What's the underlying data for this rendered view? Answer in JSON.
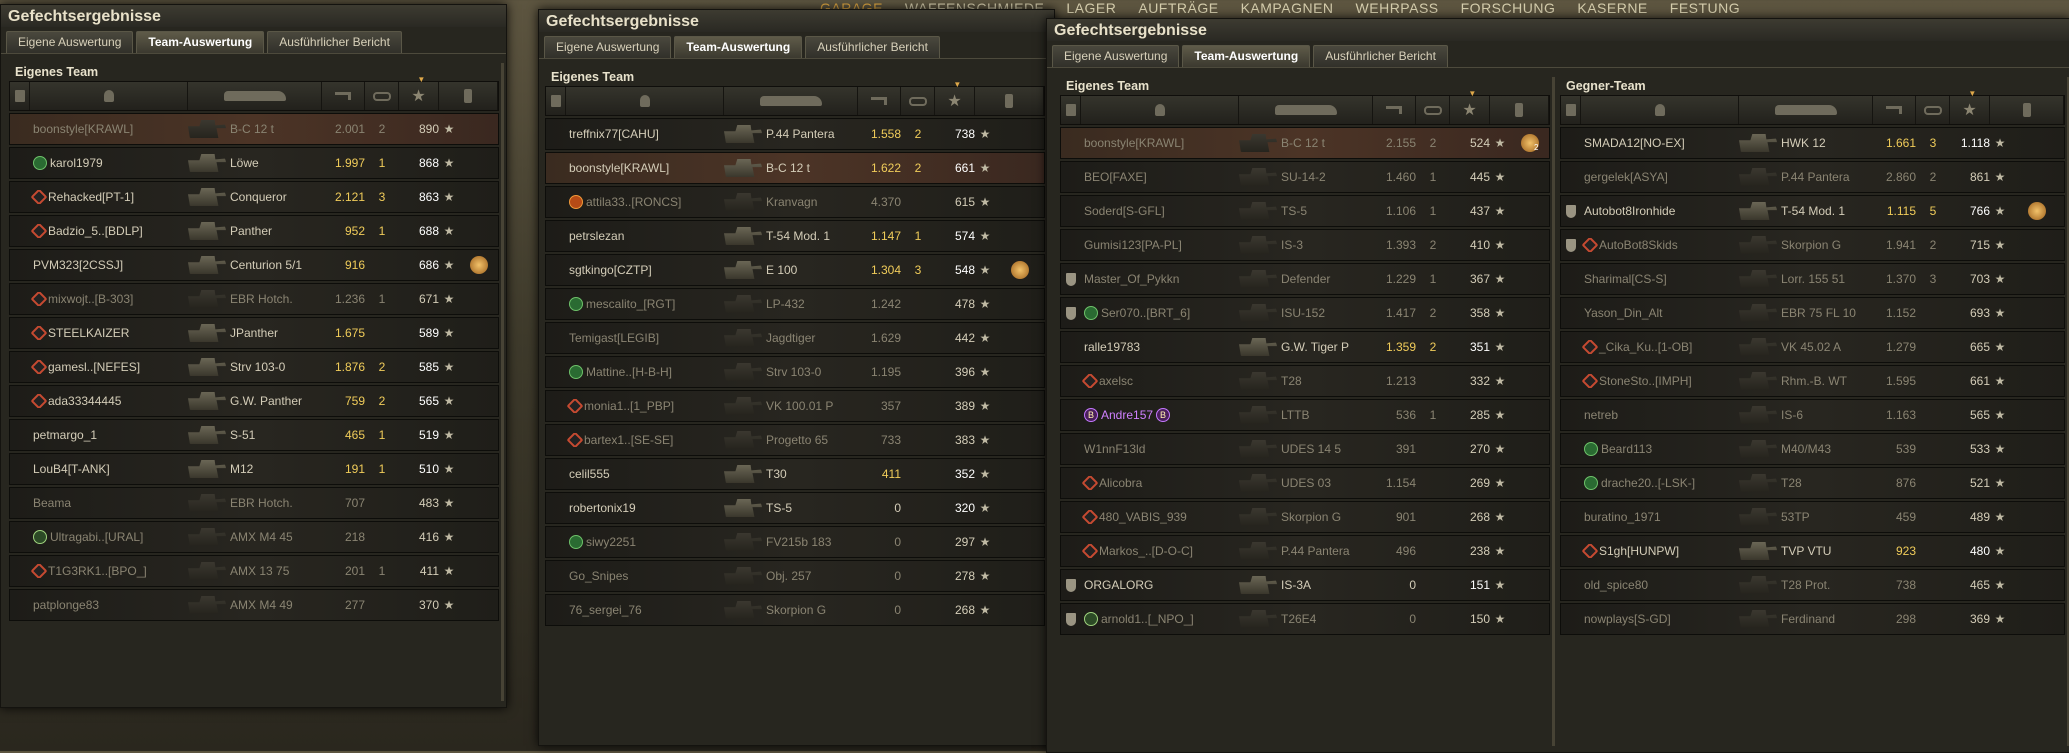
{
  "top_menu": [
    "GARAGE",
    "WAFFENSCHMIEDE",
    "LAGER",
    "AUFTRÄGE",
    "KAMPAGNEN",
    "WEHRPASS",
    "FORSCHUNG",
    "KASERNE",
    "FESTUNG"
  ],
  "windows": [
    {
      "title": "Gefechtsergebnisse",
      "tabs": [
        "Eigene Auswertung",
        "Team-Auswertung",
        "Ausführlicher Bericht"
      ],
      "active_tab": 1,
      "teams": [
        {
          "title": "Eigenes Team",
          "rows": [
            {
              "name": "boonstyle[KRAWL]",
              "tank": "B-C 12 t",
              "dmg": "2.001",
              "frags": "2",
              "xp": "890",
              "self": true,
              "dead": true
            },
            {
              "name": "karol1979",
              "tank": "Löwe",
              "dmg": "1.997",
              "frags": "1",
              "xp": "868",
              "badge": "green"
            },
            {
              "name": "Rehacked[PT-1]",
              "tank": "Conqueror",
              "dmg": "2.121",
              "frags": "3",
              "xp": "863",
              "badge": "rank"
            },
            {
              "name": "Badzio_5..[BDLP]",
              "tank": "Panther",
              "dmg": "952",
              "frags": "1",
              "xp": "688",
              "badge": "rank"
            },
            {
              "name": "PVM323[2CSSJ]",
              "tank": "Centurion 5/1",
              "dmg": "916",
              "frags": "",
              "xp": "686",
              "medal": true
            },
            {
              "name": "mixwojt..[B-303]",
              "tank": "EBR Hotch.",
              "dmg": "1.236",
              "frags": "1",
              "xp": "671",
              "badge": "rank",
              "dead": true
            },
            {
              "name": "STEELKAIZER",
              "tank": "JPanther",
              "dmg": "1.675",
              "frags": "",
              "xp": "589",
              "badge": "rank"
            },
            {
              "name": "gamesl..[NEFES]",
              "tank": "Strv 103-0",
              "dmg": "1.876",
              "frags": "2",
              "xp": "585",
              "badge": "rank"
            },
            {
              "name": "ada33344445",
              "tank": "G.W. Panther",
              "dmg": "759",
              "frags": "2",
              "xp": "565",
              "badge": "rank"
            },
            {
              "name": "petmargo_1",
              "tank": "S-51",
              "dmg": "465",
              "frags": "1",
              "xp": "519"
            },
            {
              "name": "LouB4[T-ANK]",
              "tank": "M12",
              "dmg": "191",
              "frags": "1",
              "xp": "510"
            },
            {
              "name": "Beama",
              "tank": "EBR Hotch.",
              "dmg": "707",
              "frags": "",
              "xp": "483",
              "dead": true
            },
            {
              "name": "Ultragabi..[URAL]",
              "tank": "AMX M4 45",
              "dmg": "218",
              "frags": "",
              "xp": "416",
              "badge": "star",
              "dead": true
            },
            {
              "name": "T1G3RK1..[BPO_]",
              "tank": "AMX 13 75",
              "dmg": "201",
              "frags": "1",
              "xp": "411",
              "badge": "rank",
              "dead": true
            },
            {
              "name": "patplonge83",
              "tank": "AMX M4 49",
              "dmg": "277",
              "frags": "",
              "xp": "370",
              "dead": true
            }
          ]
        }
      ]
    },
    {
      "title": "Gefechtsergebnisse",
      "tabs": [
        "Eigene Auswertung",
        "Team-Auswertung",
        "Ausführlicher Bericht"
      ],
      "active_tab": 1,
      "teams": [
        {
          "title": "Eigenes Team",
          "rows": [
            {
              "name": "treffnix77[CAHU]",
              "tank": "P.44 Pantera",
              "dmg": "1.558",
              "frags": "2",
              "xp": "738"
            },
            {
              "name": "boonstyle[KRAWL]",
              "tank": "B-C 12 t",
              "dmg": "1.622",
              "frags": "2",
              "xp": "661",
              "self": true
            },
            {
              "name": "attila33..[RONCS]",
              "tank": "Kranvagn",
              "dmg": "4.370",
              "frags": "",
              "xp": "615",
              "badge": "orange",
              "dead": true
            },
            {
              "name": "petrslezan",
              "tank": "T-54 Mod. 1",
              "dmg": "1.147",
              "frags": "1",
              "xp": "574"
            },
            {
              "name": "sgtkingo[CZTP]",
              "tank": "E 100",
              "dmg": "1.304",
              "frags": "3",
              "xp": "548",
              "medal": true
            },
            {
              "name": "mescalito_[RGT]",
              "tank": "LP-432",
              "dmg": "1.242",
              "frags": "",
              "xp": "478",
              "badge": "green",
              "dead": true
            },
            {
              "name": "Temigast[LEGIB]",
              "tank": "Jagdtiger",
              "dmg": "1.629",
              "frags": "",
              "xp": "442",
              "dead": true
            },
            {
              "name": "Mattine..[H-B-H]",
              "tank": "Strv 103-0",
              "dmg": "1.195",
              "frags": "",
              "xp": "396",
              "badge": "green",
              "dead": true
            },
            {
              "name": "monia1..[1_PBP]",
              "tank": "VK 100.01 P",
              "dmg": "357",
              "frags": "",
              "xp": "389",
              "badge": "rank",
              "dead": true
            },
            {
              "name": "bartex1..[SE-SE]",
              "tank": "Progetto 65",
              "dmg": "733",
              "frags": "",
              "xp": "383",
              "badge": "rank",
              "dead": true
            },
            {
              "name": "celil555",
              "tank": "T30",
              "dmg": "411",
              "frags": "",
              "xp": "352"
            },
            {
              "name": "robertonix19",
              "tank": "TS-5",
              "dmg": "0",
              "frags": "",
              "xp": "320"
            },
            {
              "name": "siwy2251",
              "tank": "FV215b 183",
              "dmg": "0",
              "frags": "",
              "xp": "297",
              "badge": "green",
              "dead": true
            },
            {
              "name": "Go_Snipes",
              "tank": "Obj. 257",
              "dmg": "0",
              "frags": "",
              "xp": "278",
              "dead": true
            },
            {
              "name": "76_sergei_76",
              "tank": "Skorpion G",
              "dmg": "0",
              "frags": "",
              "xp": "268",
              "dead": true
            }
          ]
        }
      ]
    },
    {
      "title": "Gefechtsergebnisse",
      "tabs": [
        "Eigene Auswertung",
        "Team-Auswertung",
        "Ausführlicher Bericht"
      ],
      "active_tab": 1,
      "teams": [
        {
          "title": "Eigenes Team",
          "rows": [
            {
              "name": "boonstyle[KRAWL]",
              "tank": "B-C 12 t",
              "dmg": "2.155",
              "frags": "2",
              "xp": "524",
              "self": true,
              "dead": true,
              "medal": true,
              "medal_num": "2"
            },
            {
              "name": "BEO[FAXE]",
              "tank": "SU-14-2",
              "dmg": "1.460",
              "frags": "1",
              "xp": "445",
              "dead": true
            },
            {
              "name": "Soderd[S-GFL]",
              "tank": "TS-5",
              "dmg": "1.106",
              "frags": "1",
              "xp": "437",
              "dead": true
            },
            {
              "name": "Gumisi123[PA-PL]",
              "tank": "IS-3",
              "dmg": "1.393",
              "frags": "2",
              "xp": "410",
              "dead": true
            },
            {
              "name": "Master_Of_Pykkn",
              "tank": "Defender",
              "dmg": "1.229",
              "frags": "1",
              "xp": "367",
              "plat": true,
              "dead": true
            },
            {
              "name": "Ser070..[BRT_6]",
              "tank": "ISU-152",
              "dmg": "1.417",
              "frags": "2",
              "xp": "358",
              "badge": "green",
              "plat": true,
              "dead": true
            },
            {
              "name": "ralle19783",
              "tank": "G.W. Tiger P",
              "dmg": "1.359",
              "frags": "2",
              "xp": "351"
            },
            {
              "name": "axelsc",
              "tank": "T28",
              "dmg": "1.213",
              "frags": "",
              "xp": "332",
              "badge": "rank",
              "dead": true
            },
            {
              "name": "Andre157",
              "tank": "LTTB",
              "dmg": "536",
              "frags": "1",
              "xp": "285",
              "badge": "purple",
              "badge_text": "B",
              "purple": true,
              "dead": true
            },
            {
              "name": "W1nnF13ld",
              "tank": "UDES 14 5",
              "dmg": "391",
              "frags": "",
              "xp": "270",
              "dead": true
            },
            {
              "name": "Alicobra",
              "tank": "UDES 03",
              "dmg": "1.154",
              "frags": "",
              "xp": "269",
              "badge": "rank",
              "dead": true
            },
            {
              "name": "480_VABIS_939",
              "tank": "Skorpion G",
              "dmg": "901",
              "frags": "",
              "xp": "268",
              "badge": "rank",
              "dead": true
            },
            {
              "name": "Markos_..[D-O-C]",
              "tank": "P.44 Pantera",
              "dmg": "496",
              "frags": "",
              "xp": "238",
              "badge": "rank",
              "dead": true
            },
            {
              "name": "ORGALORG",
              "tank": "IS-3A",
              "dmg": "0",
              "frags": "",
              "xp": "151",
              "plat": true
            },
            {
              "name": "arnold1..[_NPO_]",
              "tank": "T26E4",
              "dmg": "0",
              "frags": "",
              "xp": "150",
              "badge": "star",
              "plat": true,
              "dead": true
            }
          ]
        },
        {
          "title": "Gegner-Team",
          "rows": [
            {
              "name": "SMADA12[NO-EX]",
              "tank": "HWK 12",
              "dmg": "1.661",
              "frags": "3",
              "xp": "1.118"
            },
            {
              "name": "gergelek[ASYA]",
              "tank": "P.44 Pantera",
              "dmg": "2.860",
              "frags": "2",
              "xp": "861",
              "dead": true
            },
            {
              "name": "Autobot8Ironhide",
              "tank": "T-54 Mod. 1",
              "dmg": "1.115",
              "frags": "5",
              "xp": "766",
              "plat": true,
              "medal": true
            },
            {
              "name": "AutoBot8Skids",
              "tank": "Skorpion G",
              "dmg": "1.941",
              "frags": "2",
              "xp": "715",
              "plat": true,
              "badge": "rank",
              "dead": true
            },
            {
              "name": "Sharimal[CS-S]",
              "tank": "Lorr. 155 51",
              "dmg": "1.370",
              "frags": "3",
              "xp": "703",
              "dead": true
            },
            {
              "name": "Yason_Din_Alt",
              "tank": "EBR 75 FL 10",
              "dmg": "1.152",
              "frags": "",
              "xp": "693",
              "dead": true
            },
            {
              "name": "_Cika_Ku..[1-OB]",
              "tank": "VK 45.02 A",
              "dmg": "1.279",
              "frags": "",
              "xp": "665",
              "badge": "rank",
              "dead": true
            },
            {
              "name": "StoneSto..[IMPH]",
              "tank": "Rhm.-B. WT",
              "dmg": "1.595",
              "frags": "",
              "xp": "661",
              "badge": "rank",
              "dead": true
            },
            {
              "name": "netreb",
              "tank": "IS-6",
              "dmg": "1.163",
              "frags": "",
              "xp": "565",
              "dead": true
            },
            {
              "name": "Beard113",
              "tank": "M40/M43",
              "dmg": "539",
              "frags": "",
              "xp": "533",
              "badge": "green",
              "dead": true
            },
            {
              "name": "drache20..[-LSK-]",
              "tank": "T28",
              "dmg": "876",
              "frags": "",
              "xp": "521",
              "badge": "green",
              "dead": true
            },
            {
              "name": "buratino_1971",
              "tank": "53TP",
              "dmg": "459",
              "frags": "",
              "xp": "489",
              "dead": true
            },
            {
              "name": "S1gh[HUNPW]",
              "tank": "TVP VTU",
              "dmg": "923",
              "frags": "",
              "xp": "480",
              "badge": "rank"
            },
            {
              "name": "old_spice80",
              "tank": "T28 Prot.",
              "dmg": "738",
              "frags": "",
              "xp": "465",
              "dead": true
            },
            {
              "name": "nowplays[S-GD]",
              "tank": "Ferdinand",
              "dmg": "298",
              "frags": "",
              "xp": "369",
              "dead": true
            }
          ]
        }
      ]
    }
  ]
}
